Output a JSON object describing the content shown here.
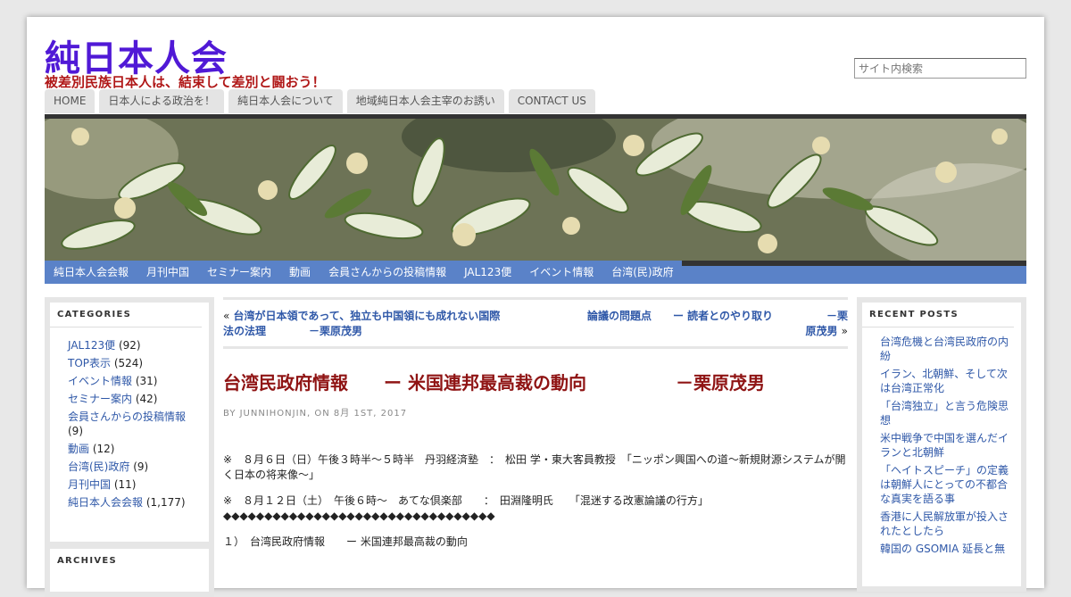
{
  "site": {
    "title": "純日本人会",
    "description": "被差別民族日本人は、結束して差別と闘おう！",
    "search_placeholder": "サイト内検索"
  },
  "top_nav": [
    {
      "label": "HOME"
    },
    {
      "label": "日本人による政治を！"
    },
    {
      "label": "純日本人会について"
    },
    {
      "label": "地域純日本人会主宰のお誘い"
    },
    {
      "label": "CONTACT US"
    }
  ],
  "category_nav": [
    {
      "label": "純日本人会会報"
    },
    {
      "label": "月刊中国"
    },
    {
      "label": "セミナー案内"
    },
    {
      "label": "動画"
    },
    {
      "label": "会員さんからの投稿情報"
    },
    {
      "label": "JAL123便"
    },
    {
      "label": "イベント情報"
    },
    {
      "label": "台湾(民)政府"
    }
  ],
  "categories_widget": {
    "title": "CATEGORIES",
    "items": [
      {
        "name": "JAL123便",
        "count": "(92)"
      },
      {
        "name": "TOP表示",
        "count": "(524)"
      },
      {
        "name": "イベント情報",
        "count": "(31)"
      },
      {
        "name": "セミナー案内",
        "count": "(42)"
      },
      {
        "name": "会員さんからの投稿情報",
        "count": "(9)"
      },
      {
        "name": "動画",
        "count": "(12)"
      },
      {
        "name": "台湾(民)政府",
        "count": "(9)"
      },
      {
        "name": "月刊中国",
        "count": "(11)"
      },
      {
        "name": "純日本人会会報",
        "count": "(1,177)"
      }
    ]
  },
  "archives_widget": {
    "title": "ARCHIVES"
  },
  "recent_posts_widget": {
    "title": "RECENT POSTS",
    "items": [
      "台湾危機と台湾民政府の内紛",
      "イラン、北朝鮮、そして次は台湾正常化",
      "「台湾独立」と言う危険思想",
      "米中戦争で中国を選んだイランと北朝鮮",
      "「ヘイトスピーチ」の定義は朝鮮人にとっての不都合な真実を語る事",
      "香港に人民解放軍が投入されたとしたら",
      "韓国の GSOMIA 延長と無"
    ]
  },
  "post_nav": {
    "prev_arrow": "«",
    "prev_line1": "台湾が日本領であって、独立も中国領にも成れない国際",
    "prev_line2": "法の法理　　　　－栗原茂男",
    "next_line1": "論議の問題点　　ー 読者とのやり取り　　　　　－栗",
    "next_line2": "原茂男",
    "next_arrow": "»"
  },
  "post": {
    "title": "台湾民政府情報　　ー 米国連邦最高裁の動向　　　　　－栗原茂男",
    "byline": "BY JUNNIHONJIN, ON 8月 1ST, 2017",
    "paragraphs": [
      "※　８月６日（日）午後３時半～５時半　丹羽経済塾　：　松田 学・東大客員教授　「ニッポン興国への道～新規財源システムが開く日本の将来像～」",
      "※　８月１２日（土）　午後６時～　あてな倶楽部　　：　田淵隆明氏　　「混迷する改憲論議の行方」\n◆◆◆◆◆◆◆◆◆◆◆◆◆◆◆◆◆◆◆◆◆◆◆◆◆◆◆◆◆◆◆◆◆",
      "１）　台湾民政府情報　　ー 米国連邦最高裁の動向"
    ]
  },
  "colors": {
    "site_title": "#5019d6",
    "site_description": "#b01818",
    "post_title": "#8f1414",
    "link": "#2f58a8",
    "category_nav_bg": "#5a82c8"
  }
}
